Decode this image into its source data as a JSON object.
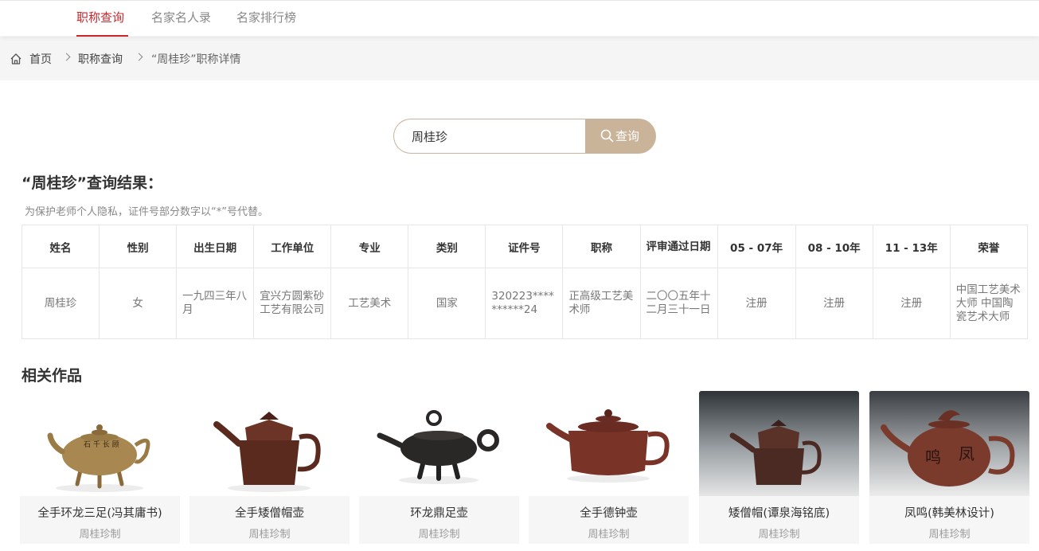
{
  "topnav": {
    "tabs": [
      {
        "label": "职称查询",
        "active": true
      },
      {
        "label": "名家名人录",
        "active": false
      },
      {
        "label": "名家排行榜",
        "active": false
      }
    ],
    "accent_color": "#c8282e"
  },
  "breadcrumb": {
    "icon": "home-icon",
    "items": [
      "首页",
      "职称查询",
      "“周桂珍”职称详情"
    ]
  },
  "search": {
    "value": "周桂珍",
    "button_label": "查询",
    "button_icon": "search-icon",
    "button_color": "#c9b49a"
  },
  "result": {
    "title": "“周桂珍”查询结果：",
    "privacy_note": "为保护老师个人隐私，证件号部分数字以“*”号代替。"
  },
  "table": {
    "headers": [
      "姓名",
      "性别",
      "出生日期",
      "工作单位",
      "专业",
      "类别",
      "证件号",
      "职称",
      "评审通过日期",
      "05 - 07年",
      "08 - 10年",
      "11 - 13年",
      "荣誉"
    ],
    "rows": [
      [
        "周桂珍",
        "女",
        "一九四三年八月",
        "宜兴方圆紫砂工艺有限公司",
        "工艺美术",
        "国家",
        "320223**********24",
        "正高级工艺美术师",
        "二〇〇五年十二月三十一日",
        "注册",
        "注册",
        "注册",
        "中国工艺美术大师 中国陶瓷艺术大师"
      ]
    ]
  },
  "works": {
    "title": "相关作品",
    "items": [
      {
        "name": "全手环龙三足(冯其庸书)",
        "maker": "周桂珍制"
      },
      {
        "name": "全手矮僧帽壶",
        "maker": "周桂珍制"
      },
      {
        "name": "环龙鼎足壶",
        "maker": "周桂珍制"
      },
      {
        "name": "全手德钟壶",
        "maker": "周桂珍制"
      },
      {
        "name": "矮僧帽(谭泉海铭底)",
        "maker": "周桂珍制"
      },
      {
        "name": "凤鸣(韩美林设计)",
        "maker": "周桂珍制"
      }
    ]
  }
}
